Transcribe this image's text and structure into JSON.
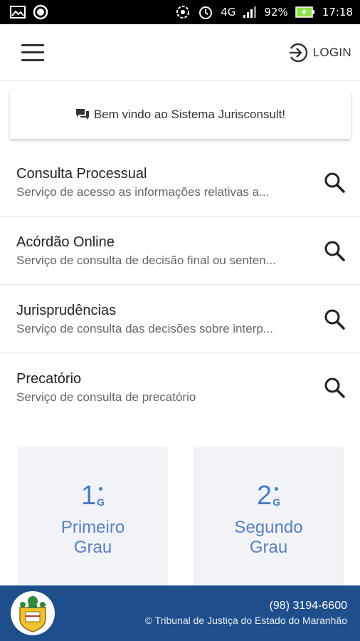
{
  "status_bar": {
    "network": "4G",
    "battery": "92%",
    "time": "17:18"
  },
  "header": {
    "login_label": "LOGIN"
  },
  "welcome": {
    "text": "Bem vindo ao Sistema Jurisconsult!"
  },
  "services": [
    {
      "title": "Consulta Processual",
      "description": "Serviço de acesso as informações relativas a..."
    },
    {
      "title": "Acórdão Online",
      "description": "Serviço de consulta de decisão final ou senten..."
    },
    {
      "title": "Jurisprudências",
      "description": "Serviço de consulta das decisões sobre interp..."
    },
    {
      "title": "Precatório",
      "description": "Serviço de consulta de precatório"
    }
  ],
  "graus": [
    {
      "number": "1",
      "suffix": "G",
      "label_line1": "Primeiro",
      "label_line2": "Grau"
    },
    {
      "number": "2",
      "suffix": "G",
      "label_line1": "Segundo",
      "label_line2": "Grau"
    }
  ],
  "footer": {
    "phone": "(98) 3194-6600",
    "copyright": "© Tribunal de Justiça do Estado do Maranhão"
  },
  "colors": {
    "footer_bg": "#1f4e8c",
    "accent_blue": "#4c78c4",
    "card_bg": "#f1f3f7"
  }
}
